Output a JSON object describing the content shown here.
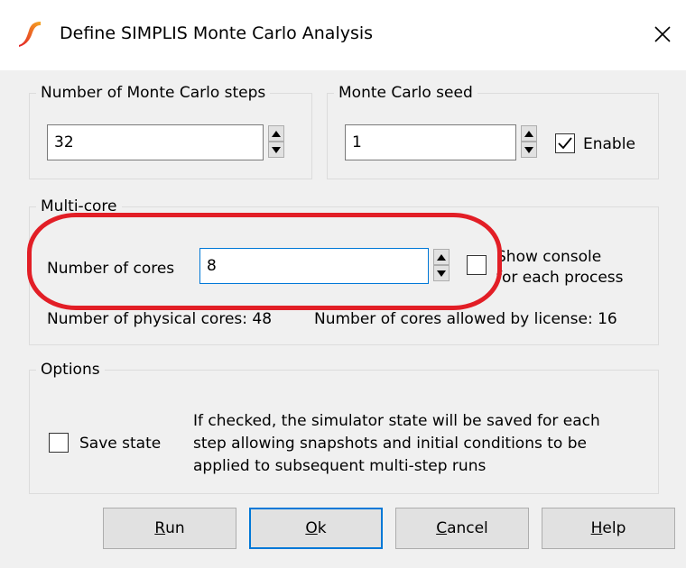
{
  "window": {
    "title": "Define SIMPLIS Monte Carlo Analysis",
    "app_icon": "simplis-logo-icon",
    "close_icon": "close-icon"
  },
  "steps": {
    "group_label": "Number of Monte Carlo steps",
    "value": "32"
  },
  "seed": {
    "group_label": "Monte Carlo seed",
    "value": "1",
    "enable_label": "Enable",
    "enable_checked": true
  },
  "multicore": {
    "group_label": "Multi-core",
    "cores_label": "Number of cores",
    "cores_value": "8",
    "show_console_line1": "Show console",
    "show_console_line2": "for each process",
    "show_console_checked": false,
    "physical_cores_text": "Number of physical cores: 48",
    "license_cores_text": "Number of cores allowed by license: 16"
  },
  "options": {
    "group_label": "Options",
    "save_state_label": "Save state",
    "save_state_checked": false,
    "description_line1": "If checked, the simulator state will be saved for each",
    "description_line2": "step allowing snapshots and initial conditions to be",
    "description_line3": "applied to subsequent multi-step runs"
  },
  "buttons": {
    "run": {
      "mnemonic": "R",
      "rest": "un"
    },
    "ok": {
      "mnemonic": "O",
      "rest": "k"
    },
    "cancel": {
      "mnemonic": "C",
      "rest": "ancel"
    },
    "help": {
      "mnemonic": "H",
      "rest": "elp"
    }
  },
  "colors": {
    "highlight": "#e21e26",
    "accent": "#0078d7",
    "logo": "#f5a623"
  }
}
